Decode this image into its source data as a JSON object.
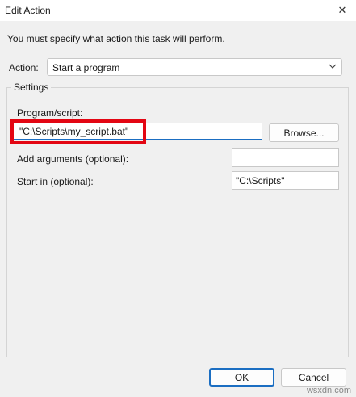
{
  "window": {
    "title": "Edit Action",
    "close_glyph": "✕"
  },
  "instruction": "You must specify what action this task will perform.",
  "action": {
    "label": "Action:",
    "value": "Start a program"
  },
  "settings": {
    "group_label": "Settings",
    "program_label": "Program/script:",
    "program_value": "\"C:\\Scripts\\my_script.bat\"",
    "browse_label": "Browse...",
    "args_label": "Add arguments (optional):",
    "args_value": "",
    "startin_label": "Start in (optional):",
    "startin_value": "\"C:\\Scripts\""
  },
  "buttons": {
    "ok": "OK",
    "cancel": "Cancel"
  },
  "watermark": "wsxdn.com",
  "colors": {
    "highlight": "#e30613",
    "accent": "#1b6ec2"
  }
}
